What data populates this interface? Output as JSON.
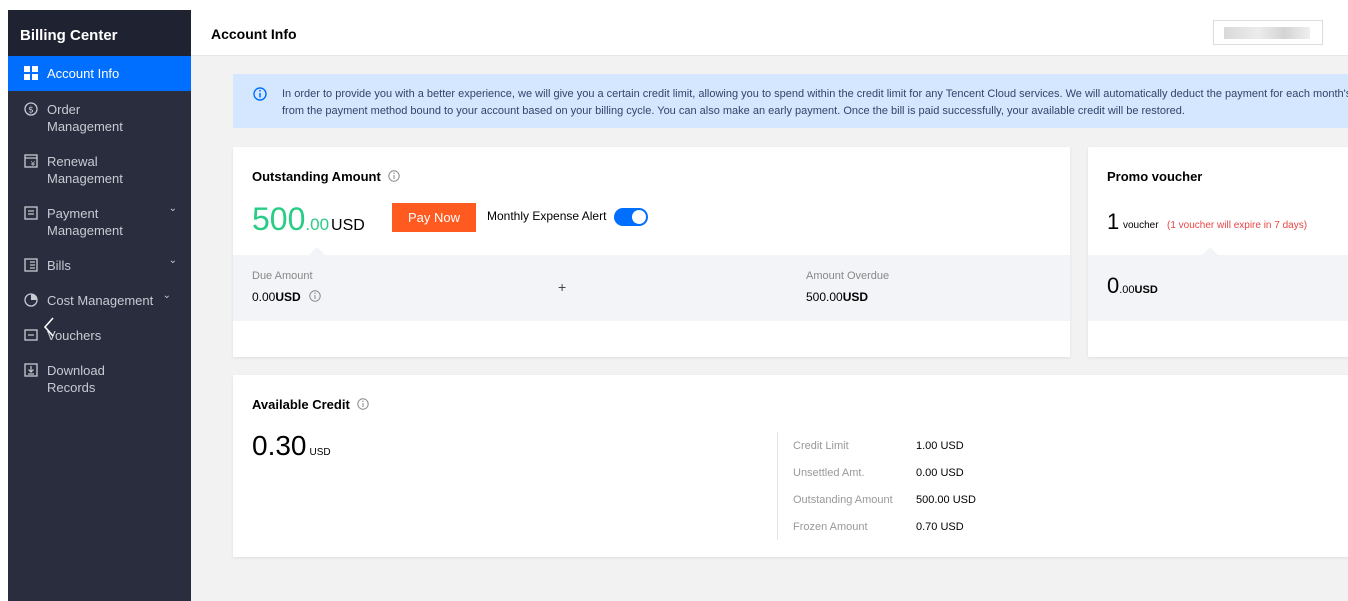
{
  "sidebar": {
    "title": "Billing Center",
    "items": [
      {
        "label": "Account Info",
        "icon": "grid-icon",
        "active": true
      },
      {
        "label": "Order Management",
        "icon": "dollar-circle-icon"
      },
      {
        "label": "Renewal Management",
        "icon": "renewal-icon"
      },
      {
        "label": "Payment Management",
        "icon": "payment-icon",
        "expandable": true
      },
      {
        "label": "Bills",
        "icon": "bill-icon",
        "expandable": true
      },
      {
        "label": "Cost Management",
        "icon": "pie-chart-icon",
        "expandable": true
      },
      {
        "label": "Vouchers",
        "icon": "voucher-icon"
      },
      {
        "label": "Download Records",
        "icon": "download-icon"
      }
    ]
  },
  "header": {
    "title": "Account Info"
  },
  "banner": {
    "text": "In order to provide you with a better experience, we will give you a certain credit limit, allowing you to spend within the credit limit for any Tencent Cloud services. We will automatically deduct the payment for each month's bill from the payment method bound to your account based on your billing cycle. You can also make an early payment. Once the bill is paid successfully, your available credit will be restored."
  },
  "outstanding": {
    "title": "Outstanding Amount",
    "amount_int": "500",
    "amount_dec": ".00",
    "currency": "USD",
    "pay_button": "Pay Now",
    "alert_label": "Monthly Expense Alert",
    "alert_enabled": true,
    "due_label": "Due Amount",
    "due_value": "0.00",
    "due_currency": "USD",
    "plus": "+",
    "overdue_label": "Amount Overdue",
    "overdue_value": "500.00",
    "overdue_currency": "USD"
  },
  "promo": {
    "title": "Promo voucher",
    "count": "1",
    "unit": "voucher",
    "expire_note": "(1 voucher will expire in 7 days)",
    "amount_int": "0",
    "amount_dec": ".00",
    "currency": "USD"
  },
  "credit": {
    "title": "Available Credit",
    "amount": "0.30",
    "currency": "USD",
    "rows": [
      {
        "label": "Credit Limit",
        "value": "1.00 USD"
      },
      {
        "label": "Unsettled Amt.",
        "value": "0.00 USD"
      },
      {
        "label": "Outstanding Amount",
        "value": "500.00 USD"
      },
      {
        "label": "Frozen Amount",
        "value": "0.70 USD"
      }
    ]
  },
  "colors": {
    "sidebar_bg": "#292d3e",
    "active_blue": "#006eff",
    "amount_green": "#29cc85",
    "pay_orange": "#ff5a1f",
    "expire_red": "#e54545",
    "banner_bg": "#d5e7fe"
  }
}
